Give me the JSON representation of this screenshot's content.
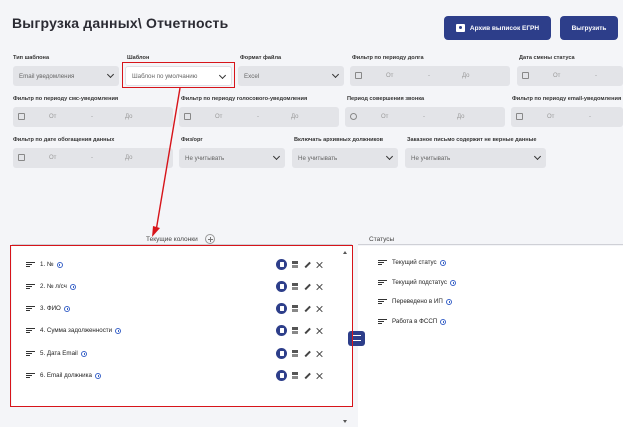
{
  "header": {
    "title": "Выгрузка данных\\ Отчетность",
    "archive_button": "Архив выписок ЕГРН",
    "export_button": "Выгрузить"
  },
  "filters": {
    "template_type": {
      "label": "Тип шаблона",
      "value": "Email уведомления"
    },
    "template": {
      "label": "Шаблон",
      "value": "Шаблон по умолчанию"
    },
    "file_format": {
      "label": "Формат файла",
      "value": "Excel"
    },
    "debt_period": {
      "label": "Фильтр по периоду долга",
      "from": "От",
      "to": "До"
    },
    "status_date": {
      "label": "Дата смены статуса",
      "from": "От"
    },
    "sms_period": {
      "label": "Фильтр по периоду смс-уведомления",
      "from": "От",
      "to": "До"
    },
    "voice_period": {
      "label": "Фильтр по периоду голосового-уведомления",
      "from": "От",
      "to": "До"
    },
    "call_period": {
      "label": "Период совершения звонка",
      "from": "От",
      "to": "До"
    },
    "email_period": {
      "label": "Фильтр по периоду email-уведомления",
      "from": "От"
    },
    "appeal_date": {
      "label": "Фильтр по дате обогащения данных",
      "from": "От",
      "to": "До"
    },
    "person_type": {
      "label": "Физ/орг",
      "value": "Не учитывать"
    },
    "archived_debtors": {
      "label": "Включать архивных должников",
      "value": "Не учитывать"
    },
    "wrong_data": {
      "label": "Заказное письмо содержит не верные данные",
      "value": "Не учитывать"
    }
  },
  "columns": {
    "current_header": "Текущие колонки",
    "statuses_header": "Статусы",
    "current": [
      "1. №",
      "2. № л/сч",
      "3. ФИО",
      "4. Сумма задолженности",
      "5. Дата Email",
      "6. Email должника"
    ],
    "statuses": [
      "Текущий статус",
      "Текущий подстатус",
      "Переведено в ИП",
      "Работа в ФССП"
    ]
  },
  "colors": {
    "accent": "#2d3e8a",
    "highlight": "#d7141a"
  }
}
